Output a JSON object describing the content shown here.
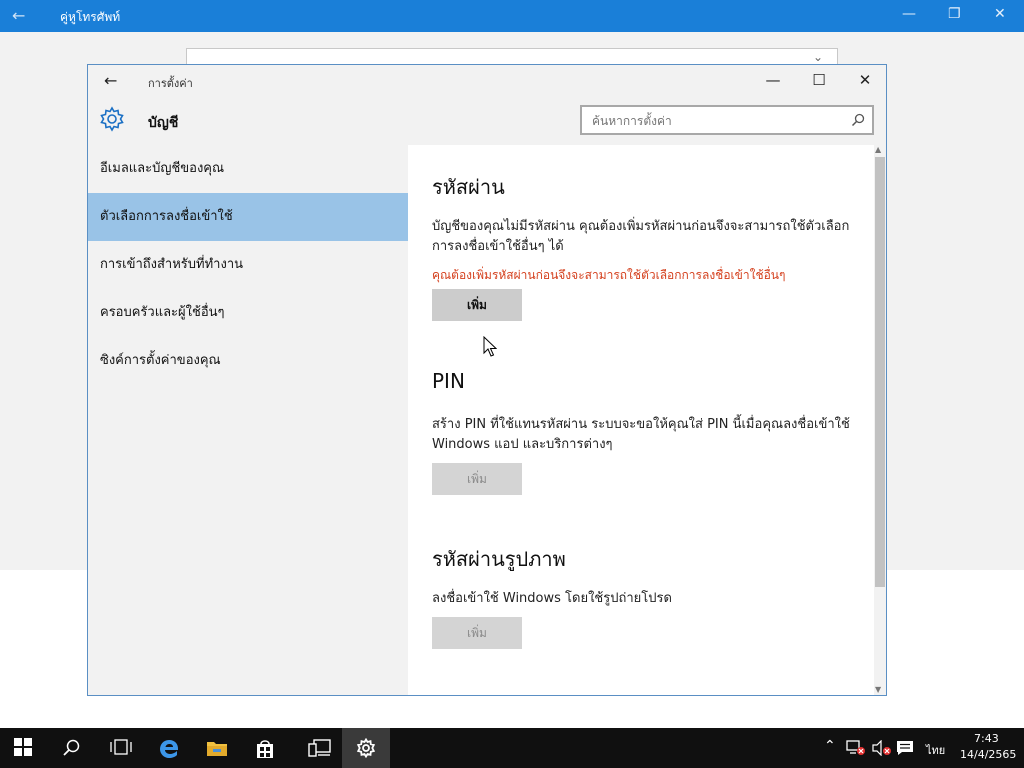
{
  "background_app": {
    "title": "คู่หูโทรศัพท์"
  },
  "settings_window": {
    "title": "การตั้งค่า",
    "section_title": "บัญชี",
    "search": {
      "placeholder": "ค้นหาการตั้งค่า"
    }
  },
  "nav": {
    "items": [
      {
        "label": "อีเมลและบัญชีของคุณ",
        "selected": false
      },
      {
        "label": "ตัวเลือกการลงชื่อเข้าใช้",
        "selected": true
      },
      {
        "label": "การเข้าถึงสำหรับที่ทำงาน",
        "selected": false
      },
      {
        "label": "ครอบครัวและผู้ใช้อื่นๆ",
        "selected": false
      },
      {
        "label": "ซิงค์การตั้งค่าของคุณ",
        "selected": false
      }
    ]
  },
  "content": {
    "password": {
      "heading": "รหัสผ่าน",
      "description": "บัญชีของคุณไม่มีรหัสผ่าน คุณต้องเพิ่มรหัสผ่านก่อนจึงจะสามารถใช้ตัวเลือกการลงชื่อเข้าใช้อื่นๆ ได้",
      "warning": "คุณต้องเพิ่มรหัสผ่านก่อนจึงจะสามารถใช้ตัวเลือกการลงชื่อเข้าใช้อื่นๆ",
      "button": "เพิ่ม"
    },
    "pin": {
      "heading": "PIN",
      "description": "สร้าง PIN ที่ใช้แทนรหัสผ่าน ระบบจะขอให้คุณใส่ PIN นี้เมื่อคุณลงชื่อเข้าใช้ Windows แอป และบริการต่างๆ",
      "button": "เพิ่ม"
    },
    "picture_password": {
      "heading": "รหัสผ่านรูปภาพ",
      "description": "ลงชื่อเข้าใช้ Windows โดยใช้รูปถ่ายโปรด",
      "button": "เพิ่ม"
    }
  },
  "taskbar": {
    "language": "ไทย",
    "time": "7:43",
    "date": "14/4/2565",
    "icons": [
      "windows-start-icon",
      "search-icon",
      "task-view-icon",
      "edge-icon",
      "file-explorer-icon",
      "store-icon",
      "phone-companion-icon",
      "settings-gear-icon"
    ]
  },
  "colors": {
    "accent": "#1a7fd8",
    "selected_nav": "#99c3e7",
    "warning": "#d43f1c"
  }
}
